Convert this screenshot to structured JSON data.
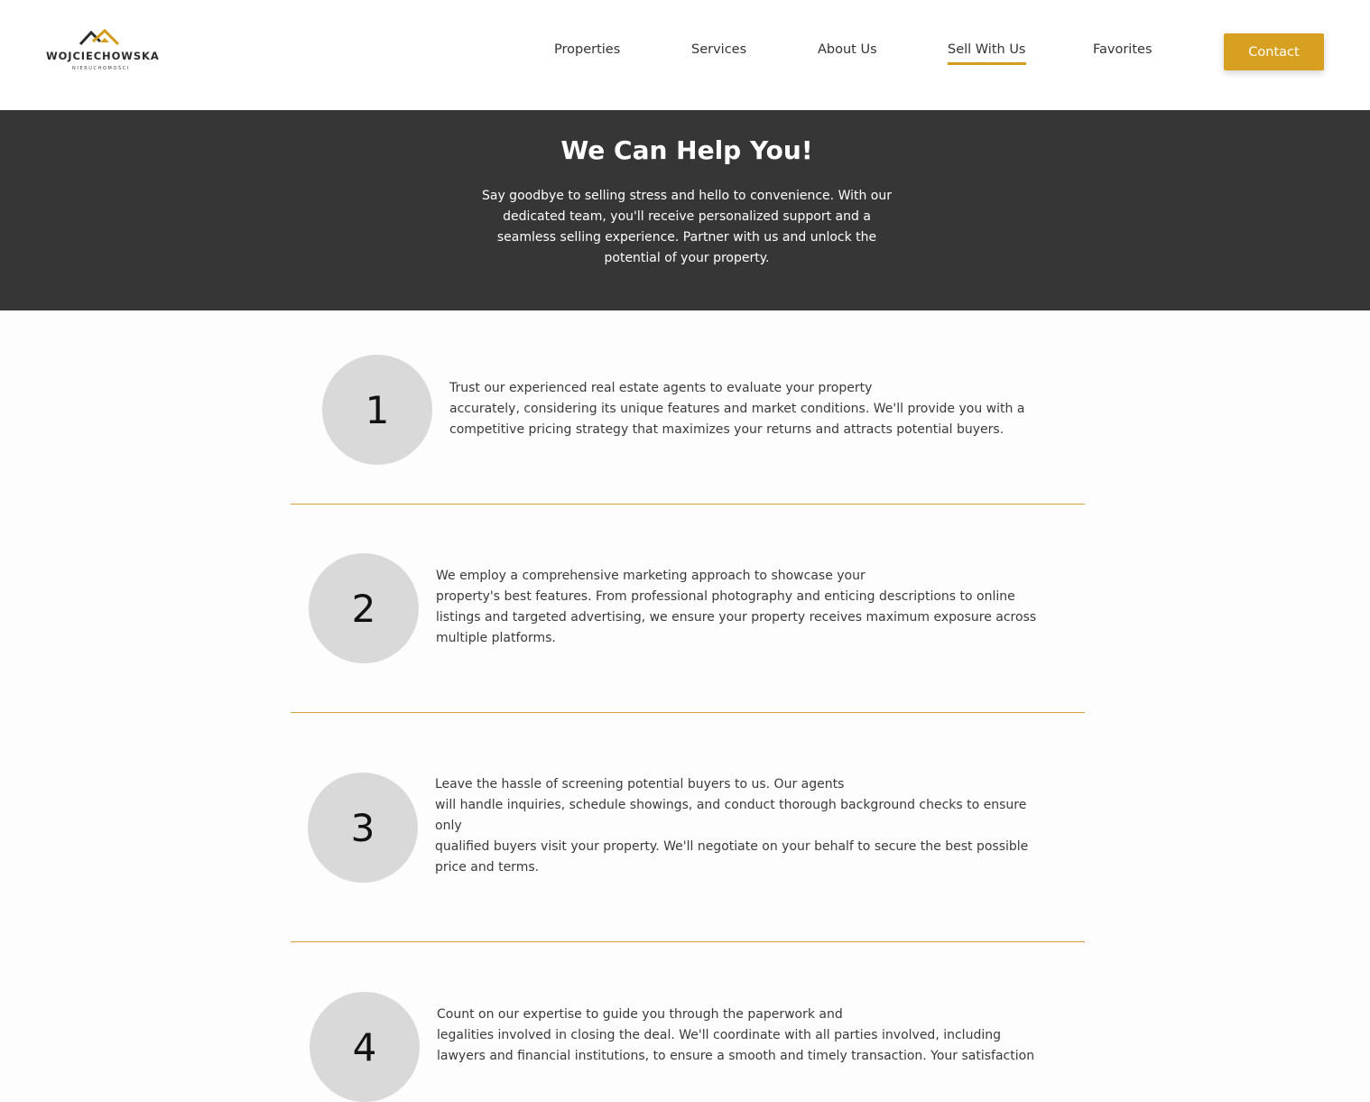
{
  "header": {
    "logo": {
      "name": "WOJCIECHOWSKA",
      "subtitle": "NIERUCHOMOŚCI"
    },
    "nav": [
      {
        "label": "Properties"
      },
      {
        "label": "Services"
      },
      {
        "label": "About Us"
      },
      {
        "label": "Sell With Us",
        "active": true
      },
      {
        "label": "Favorites"
      }
    ],
    "contact_label": "Contact"
  },
  "hero": {
    "title": "We Can Help You!",
    "lines": [
      "Say goodbye to selling stress and hello to convenience. With our",
      "dedicated team, you'll receive personalized support and a",
      "seamless selling experience. Partner with us and unlock the",
      "potential of your property."
    ]
  },
  "steps": [
    {
      "number": "1",
      "lines": [
        "Trust our experienced real estate agents to evaluate your property",
        "accurately, considering its unique features and market conditions. We'll provide you with a",
        "competitive pricing strategy that maximizes your returns and attracts potential buyers."
      ]
    },
    {
      "number": "2",
      "lines": [
        "We employ a comprehensive marketing approach to showcase your",
        "property's best features. From professional photography and enticing descriptions to online",
        "listings and targeted advertising, we ensure your property receives maximum exposure across",
        "multiple platforms."
      ]
    },
    {
      "number": "3",
      "lines": [
        "Leave the hassle of screening potential buyers to us. Our agents",
        "will handle inquiries, schedule showings, and conduct thorough background checks to ensure",
        "only",
        "qualified buyers visit your property. We'll negotiate on your behalf to secure the best possible",
        "price and terms."
      ]
    },
    {
      "number": "4",
      "lines": [
        "Count on our expertise to guide you through the paperwork and",
        "legalities involved in closing the deal. We'll coordinate with all parties involved, including",
        "lawyers and financial institutions, to ensure a smooth and timely transaction. Your satisfaction"
      ]
    }
  ],
  "colors": {
    "accent": "#d8a020",
    "hero_bg": "#363636",
    "circle": "#d9d9d9",
    "divider": "#d3a13a"
  }
}
